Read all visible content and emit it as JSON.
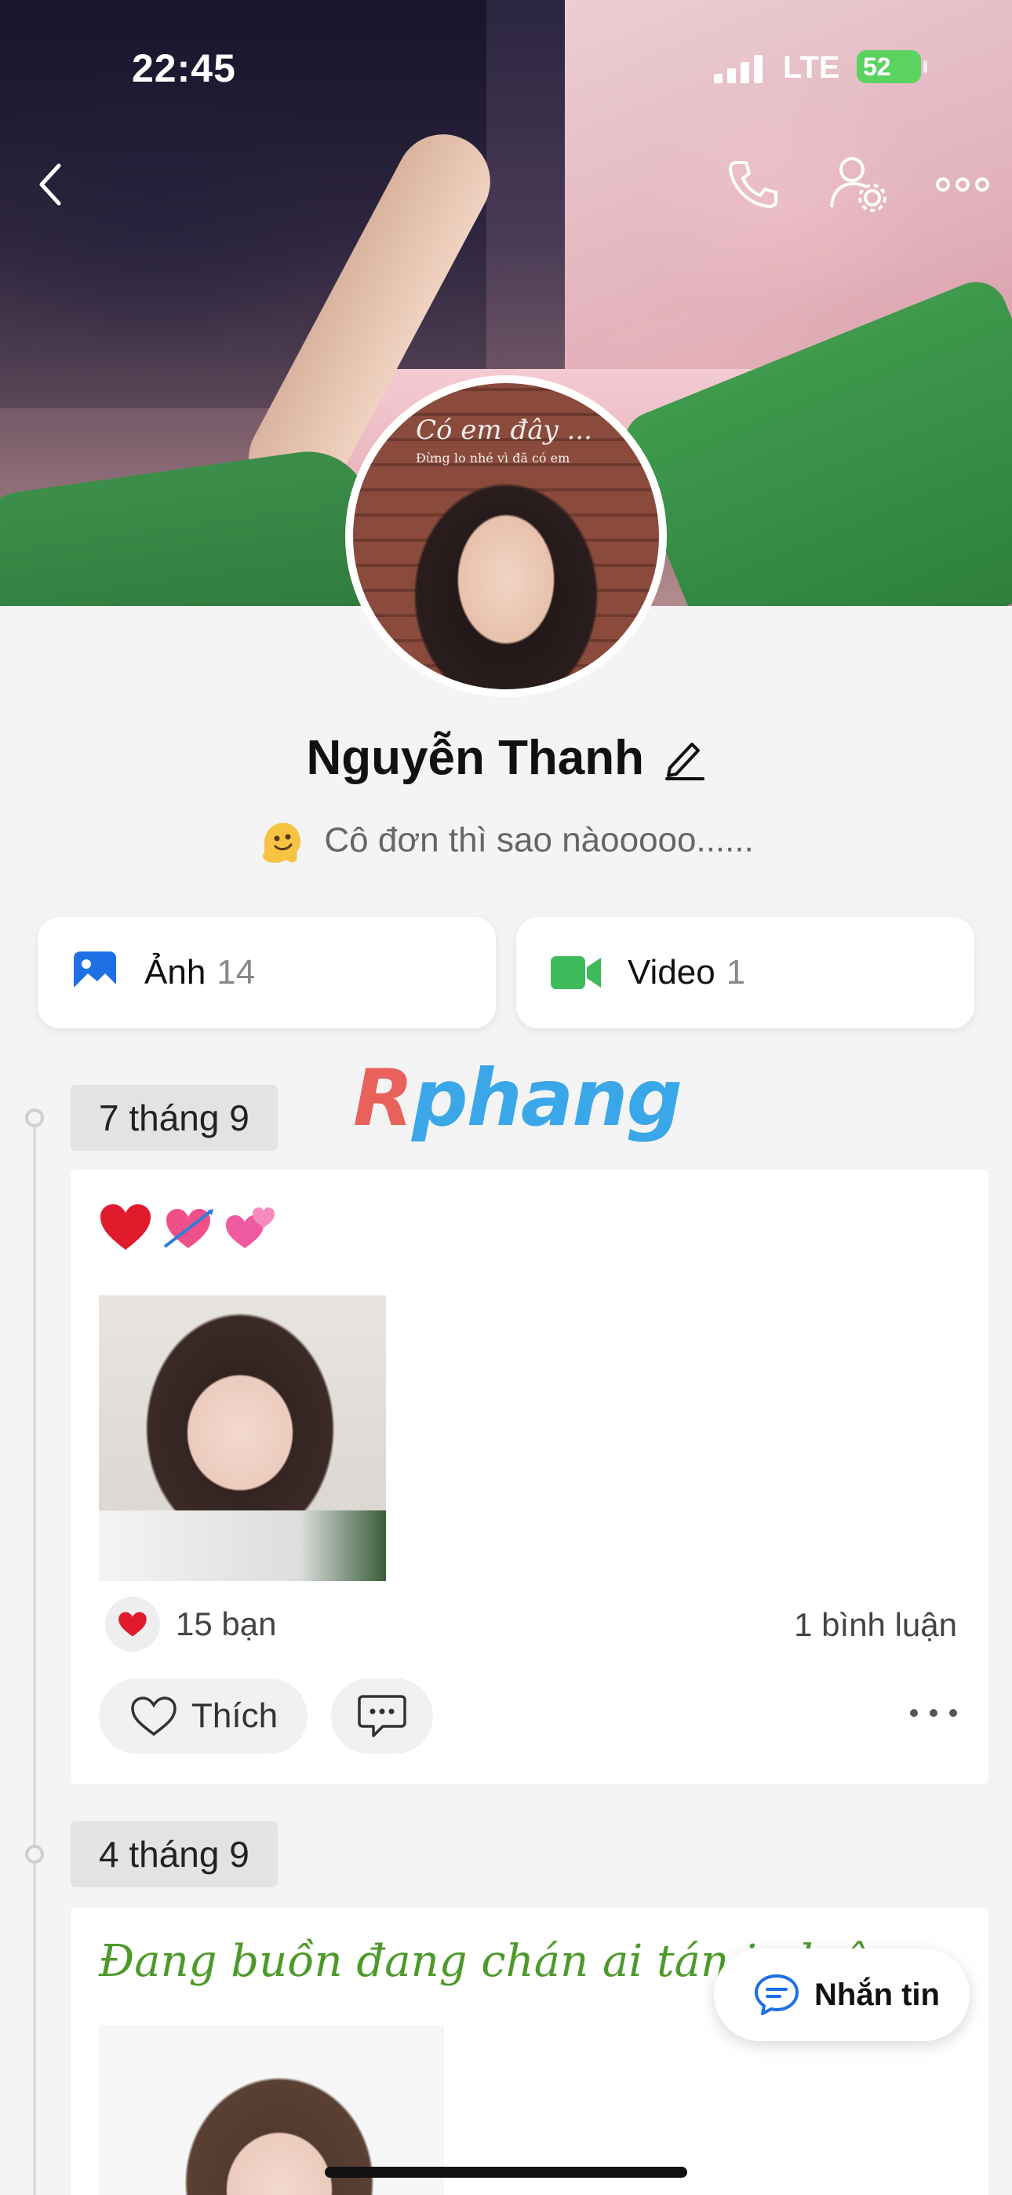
{
  "status_bar": {
    "time": "22:45",
    "network": "LTE",
    "battery": "52"
  },
  "profile": {
    "name": "Nguyễn Thanh",
    "bio": "Cô đơn thì sao nàooooo......",
    "avatar_caption": "Có em đây ...",
    "avatar_subcaption": "Đừng lo nhé vì đã có em"
  },
  "media": {
    "photos_label": "Ảnh",
    "photos_count": "14",
    "videos_label": "Video",
    "videos_count": "1"
  },
  "watermark": {
    "first": "R",
    "rest": "phang"
  },
  "timeline": {
    "posts": [
      {
        "date": "7 tháng 9",
        "reactions": "15 bạn",
        "comments": "1 bình luận",
        "like_label": "Thích"
      },
      {
        "date": "4 tháng 9",
        "text": "Đang buồn đang chán ai tán iu luôn"
      }
    ]
  },
  "message_button": {
    "label": "Nhắn tin"
  },
  "colors": {
    "accent_blue": "#1f6fe5",
    "video_green": "#3dbb5b",
    "heart_red": "#e01b2c",
    "post_text_green": "#4d9a2a"
  }
}
